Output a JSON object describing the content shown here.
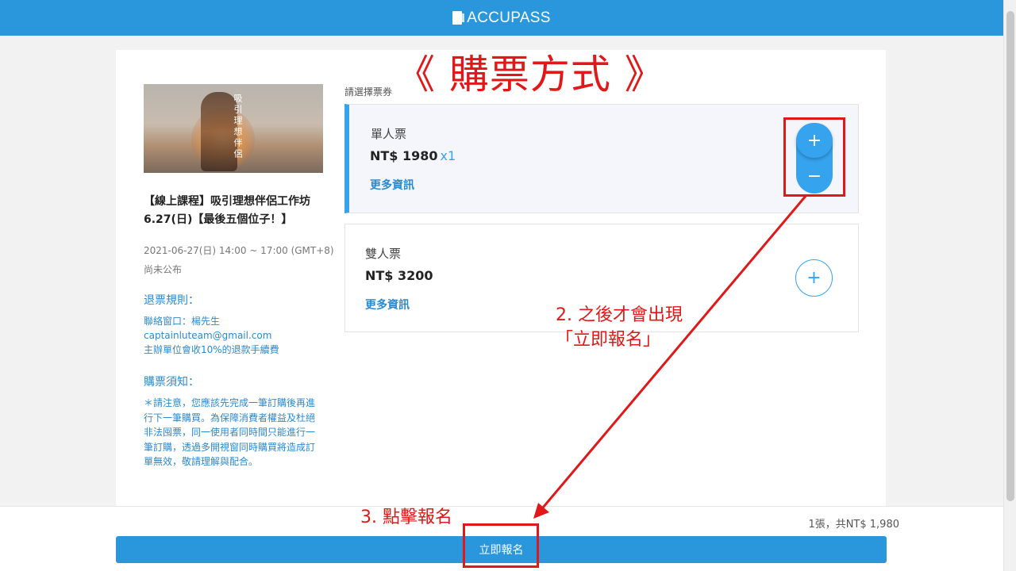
{
  "header": {
    "brand": "ACCUPASS",
    "logo_icon": "accupass-logo-icon"
  },
  "event": {
    "title": "【線上課程】吸引理想伴侶工作坊6.27(日)【最後五個位子！】",
    "image_text": "吸引理想伴侶",
    "date": "2021-06-27(日) 14:00 ~ 17:00 (GMT+8)",
    "venue": "尚未公布",
    "refund_heading": "退票規則：",
    "refund_lines": [
      "聯絡窗口：楊先生",
      "captainluteam@gmail.com",
      "主辦單位會收10%的退款手續費"
    ],
    "notice_heading": "購票須知：",
    "notice_text": "＊請注意，您應該先完成一筆訂購後再進行下一筆購買。為保障消費者權益及杜絕非法囤票，同一使用者同時間只能進行一筆訂購，透過多開視窗同時購買將造成訂單無效，敬請理解與配合。"
  },
  "ticket_section": {
    "label": "請選擇票券"
  },
  "tickets": [
    {
      "name": "單人票",
      "price": "NT$ 1980",
      "qty": "x1",
      "more": "更多資訊",
      "plus": "+",
      "minus": "−"
    },
    {
      "name": "雙人票",
      "price": "NT$ 3200",
      "more": "更多資訊",
      "plus": "+"
    }
  ],
  "footer": {
    "summary": "1張，共NT$ 1,980",
    "register_label": "立即報名"
  },
  "annotations": {
    "title": "《 購票方式 》",
    "step2_line1": "2. 之後才會出現",
    "step2_line2": "「立即報名」",
    "step3": "3. 點擊報名",
    "color": "#e21717"
  },
  "colors": {
    "brand": "#2a96dc",
    "accent": "#36a3ef",
    "link": "#2a8ad0"
  }
}
